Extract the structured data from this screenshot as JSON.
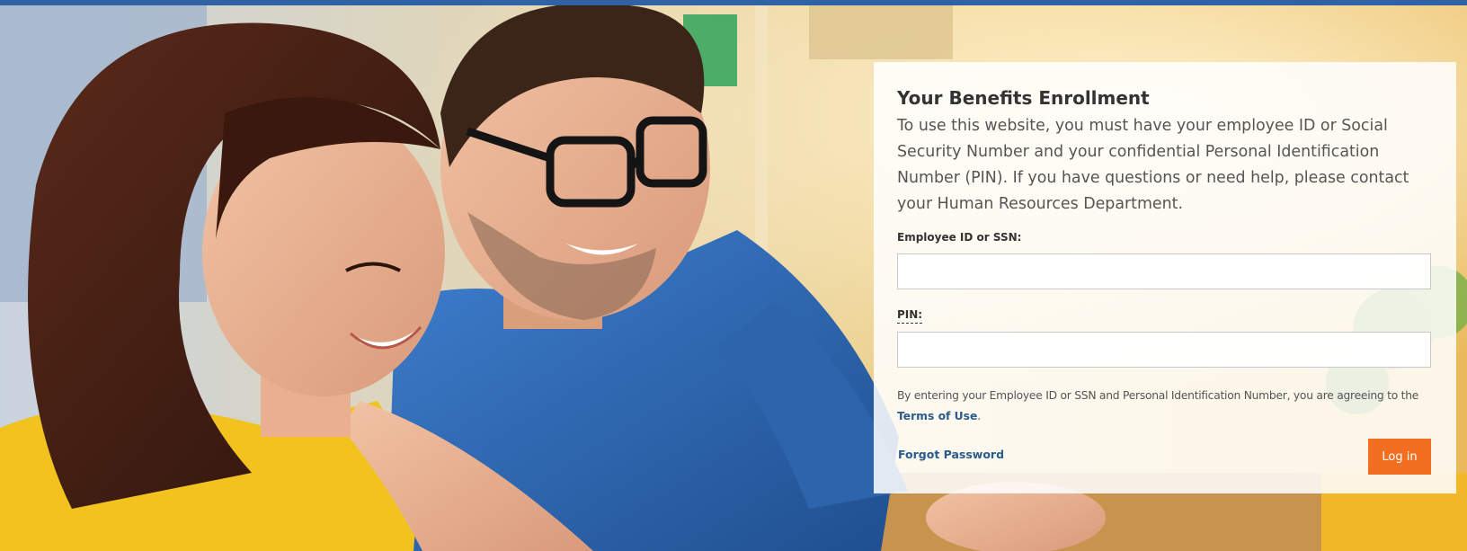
{
  "panel": {
    "title": "Your Benefits Enrollment",
    "intro": "To use this website, you must have your employee ID or Social Security Number and your confidential Personal Identification Number (PIN). If you have questions or need help, please contact your Human Resources Department.",
    "employee_id_label": "Employee ID or SSN:",
    "employee_id_value": "",
    "pin_label": "PIN:",
    "pin_value": "",
    "agreement_text": "By entering your Employee ID or SSN and Personal Identification Number, you are agreeing to the",
    "terms_link": "Terms of Use",
    "agreement_end": ".",
    "forgot_password": "Forgot Password",
    "login_button": "Log in"
  },
  "colors": {
    "top_bar": "#2f63a5",
    "accent_button": "#f26f21",
    "link": "#2a5b8c"
  }
}
